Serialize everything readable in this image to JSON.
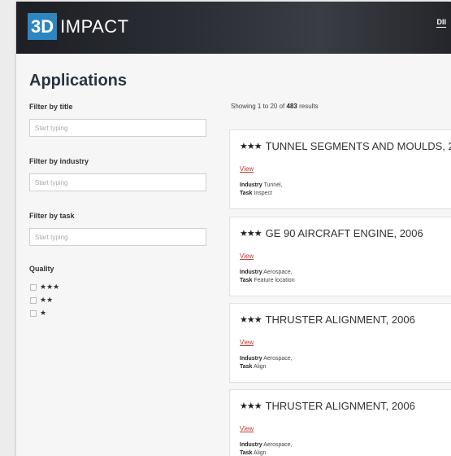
{
  "header": {
    "logo_badge": "3D",
    "logo_word": "IMPACT",
    "nav_link": "DII"
  },
  "page": {
    "title": "Applications"
  },
  "filters": {
    "title_label": "Filter by title",
    "title_placeholder": "Start typing",
    "industry_label": "Filter by industry",
    "industry_placeholder": "Start typing",
    "task_label": "Filter by task",
    "task_placeholder": "Start typing",
    "quality_label": "Quality",
    "quality_options": [
      "★★★",
      "★★",
      "★"
    ]
  },
  "results": {
    "prefix": "Showing 1 to 20 of",
    "total": "483",
    "suffix": "results"
  },
  "industry_key": "Industry",
  "task_key": "Task",
  "view_label": "View",
  "cards": [
    {
      "stars": "★★★",
      "title": "TUNNEL SEGMENTS AND MOULDS, 2",
      "industry": "Tunnel,",
      "task": "Inspect"
    },
    {
      "stars": "★★★",
      "title": "GE 90 AIRCRAFT ENGINE, 2006",
      "industry": "Aerospace,",
      "task": "Feature location"
    },
    {
      "stars": "★★★",
      "title": "THRUSTER ALIGNMENT, 2006",
      "industry": "Aerospace,",
      "task": "Align"
    },
    {
      "stars": "★★★",
      "title": "THRUSTER ALIGNMENT, 2006",
      "industry": "Aerospace,",
      "task": "Align"
    }
  ],
  "colors": {
    "logo_blue": "#2e86c1",
    "link_red": "#c0392b",
    "title_dark": "#2a3440"
  }
}
